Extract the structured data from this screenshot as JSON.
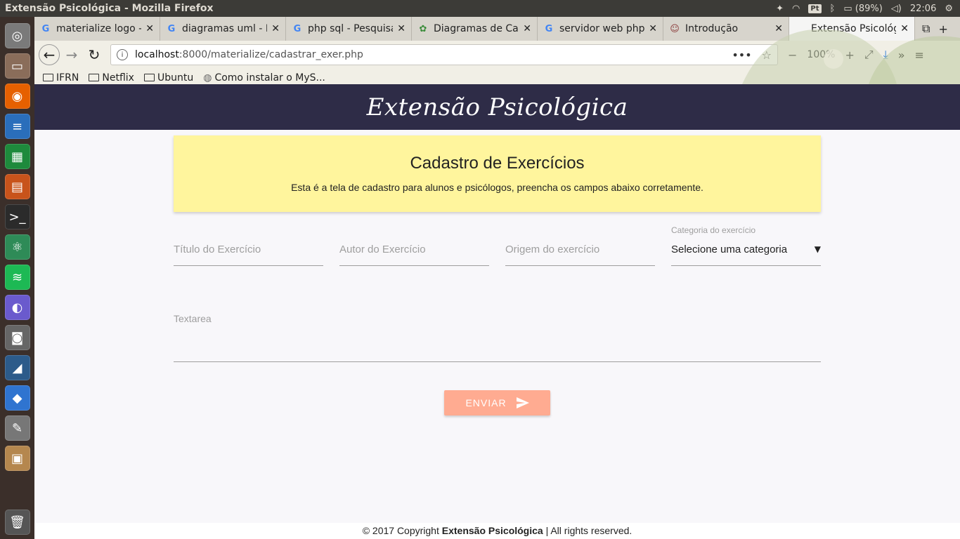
{
  "system": {
    "window_title": "Extensão Psicológica - Mozilla Firefox",
    "keyboard_layout": "Pt",
    "battery": "(89%)",
    "clock": "22:06"
  },
  "launcher": {
    "items": [
      {
        "name": "ubuntu-dash-icon",
        "color": "#7a7a7a",
        "glyph": "◎"
      },
      {
        "name": "files-icon",
        "color": "#8a6d5a",
        "glyph": "▭"
      },
      {
        "name": "firefox-icon",
        "color": "#e66000",
        "glyph": "◉"
      },
      {
        "name": "writer-icon",
        "color": "#2a6ebb",
        "glyph": "≡"
      },
      {
        "name": "calc-icon",
        "color": "#1e8a3c",
        "glyph": "▦"
      },
      {
        "name": "impress-icon",
        "color": "#c8531b",
        "glyph": "▤"
      },
      {
        "name": "terminal-icon",
        "color": "#2b2b2b",
        "glyph": ">_"
      },
      {
        "name": "atom-icon",
        "color": "#2e8b57",
        "glyph": "⚛"
      },
      {
        "name": "spotify-icon",
        "color": "#1db954",
        "glyph": "≋"
      },
      {
        "name": "color-picker-icon",
        "color": "#6a5acd",
        "glyph": "◐"
      },
      {
        "name": "camera-icon",
        "color": "#666666",
        "glyph": "◙"
      },
      {
        "name": "mysql-workbench-icon",
        "color": "#2c5b8a",
        "glyph": "◢"
      },
      {
        "name": "dropbox-icon",
        "color": "#2f74d0",
        "glyph": "◆"
      },
      {
        "name": "text-editor-icon",
        "color": "#777777",
        "glyph": "✎"
      },
      {
        "name": "archive-icon",
        "color": "#b5874e",
        "glyph": "▣"
      }
    ],
    "trash": {
      "name": "trash-icon",
      "color": "#555555",
      "glyph": "🗑"
    }
  },
  "tabs": [
    {
      "label": "materialize logo -",
      "fav": "G",
      "fav_color": "#4285f4"
    },
    {
      "label": "diagramas uml - P",
      "fav": "G",
      "fav_color": "#4285f4"
    },
    {
      "label": "php sql - Pesquisa",
      "fav": "G",
      "fav_color": "#4285f4"
    },
    {
      "label": "Diagramas de Cas",
      "fav": "✿",
      "fav_color": "#3a8c3a"
    },
    {
      "label": "servidor web php",
      "fav": "G",
      "fav_color": "#4285f4"
    },
    {
      "label": "Introdução",
      "fav": "☺",
      "fav_color": "#8b3a3a"
    },
    {
      "label": "Extensão Psicológic",
      "fav": "",
      "fav_color": "#222222"
    }
  ],
  "navbar": {
    "url_host": "localhost",
    "url_path": ":8000/materialize/cadastrar_exer.php",
    "zoom": "100%"
  },
  "bookmarks": [
    {
      "label": "IFRN",
      "type": "folder"
    },
    {
      "label": "Netflix",
      "type": "folder"
    },
    {
      "label": "Ubuntu",
      "type": "folder"
    },
    {
      "label": "Como instalar o MyS...",
      "type": "globe"
    }
  ],
  "site": {
    "title": "Extensão Psicológica",
    "header_color": "#2e2c47",
    "card": {
      "title": "Cadastro de Exercícios",
      "description": "Esta é a tela de cadastro para alunos e psicólogos, preencha os campos abaixo corretamente.",
      "color": "#fff59d"
    },
    "form": {
      "titulo_placeholder": "Título do Exercício",
      "autor_placeholder": "Autor do Exercício",
      "origem_placeholder": "Origem do exercício",
      "categoria_label": "Categoria do exercício",
      "categoria_value": "Selecione uma categoria",
      "textarea_placeholder": "Textarea",
      "submit_label": "ENVIAR",
      "submit_color": "#ffab91"
    },
    "footer": {
      "prefix": "© 2017 Copyright ",
      "brand": "Extensão Psicológica",
      "suffix": " | All rights reserved."
    }
  }
}
